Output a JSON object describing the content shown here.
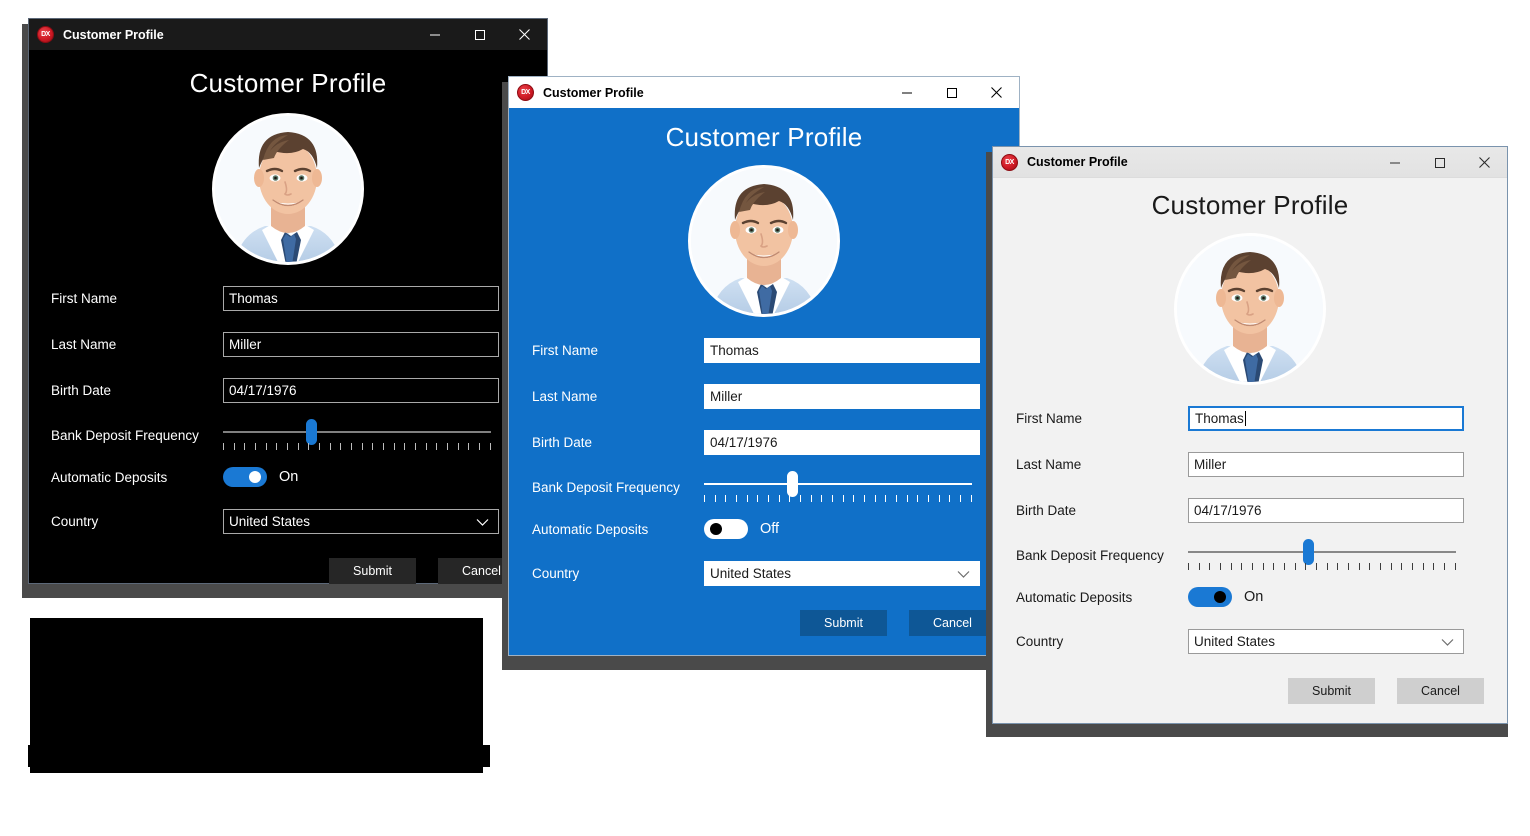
{
  "windows": [
    {
      "id": "dark",
      "theme_name": "dark",
      "titlebar": {
        "logo": "dx-logo-icon",
        "title": "Customer Profile",
        "minimize": "—",
        "maximize": "☐",
        "close": "✕"
      },
      "heading": "Customer Profile",
      "avatar_alt": "customer-photo",
      "fields": {
        "first_name_label": "First Name",
        "first_name_value": "Thomas",
        "last_name_label": "Last Name",
        "last_name_value": "Miller",
        "birth_date_label": "Birth Date",
        "birth_date_value": "04/17/1976",
        "frequency_label": "Bank Deposit Frequency",
        "frequency_percent": 33,
        "auto_deposits_label": "Automatic Deposits",
        "auto_deposits_state": "On",
        "country_label": "Country",
        "country_value": "United States"
      },
      "buttons": {
        "submit": "Submit",
        "cancel": "Cancel"
      },
      "colors": {
        "background": "#000000",
        "accent": "#1a79d4",
        "text": "#ffffff"
      }
    },
    {
      "id": "blue",
      "theme_name": "blue",
      "titlebar": {
        "logo": "dx-logo-icon",
        "title": "Customer Profile",
        "minimize": "—",
        "maximize": "☐",
        "close": "✕"
      },
      "heading": "Customer Profile",
      "avatar_alt": "customer-photo",
      "fields": {
        "first_name_label": "First Name",
        "first_name_value": "Thomas",
        "last_name_label": "Last Name",
        "last_name_value": "Miller",
        "birth_date_label": "Birth Date",
        "birth_date_value": "04/17/1976",
        "frequency_label": "Bank Deposit Frequency",
        "frequency_percent": 33,
        "auto_deposits_label": "Automatic Deposits",
        "auto_deposits_state": "Off",
        "country_label": "Country",
        "country_value": "United States"
      },
      "buttons": {
        "submit": "Submit",
        "cancel": "Cancel"
      },
      "colors": {
        "background": "#1070c8",
        "accent": "#ffffff",
        "text": "#ffffff"
      }
    },
    {
      "id": "light",
      "theme_name": "light",
      "titlebar": {
        "logo": "dx-logo-icon",
        "title": "Customer Profile",
        "minimize": "—",
        "maximize": "☐",
        "close": "✕"
      },
      "heading": "Customer Profile",
      "avatar_alt": "customer-photo",
      "fields": {
        "first_name_label": "First Name",
        "first_name_value": "Thomas",
        "last_name_label": "Last Name",
        "last_name_value": "Miller",
        "birth_date_label": "Birth Date",
        "birth_date_value": "04/17/1976",
        "frequency_label": "Bank Deposit Frequency",
        "frequency_percent": 45,
        "auto_deposits_label": "Automatic Deposits",
        "auto_deposits_state": "On",
        "country_label": "Country",
        "country_value": "United States"
      },
      "buttons": {
        "submit": "Submit",
        "cancel": "Cancel"
      },
      "colors": {
        "background": "#f2f2f2",
        "accent": "#1a79d4",
        "text": "#1a1a1a"
      }
    }
  ]
}
